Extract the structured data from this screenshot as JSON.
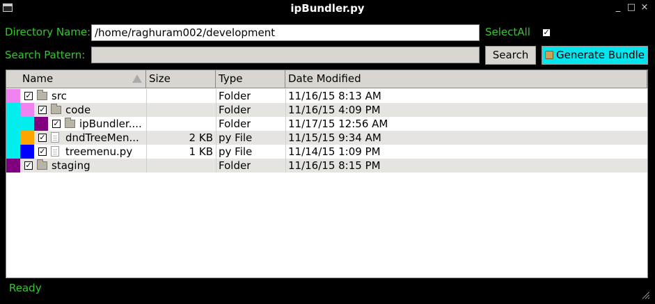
{
  "window": {
    "title": "ipBundler.py",
    "controls": [
      "_",
      "□",
      "×"
    ]
  },
  "form": {
    "dir_label": "Directory Name:",
    "dir_value": "/home/raghuram002/development",
    "selectall_label": "SelectAll",
    "selectall_checked": "✓",
    "pattern_label": "Search Pattern:",
    "pattern_value": "",
    "search_button": "Search",
    "generate_button": "Generate Bundle"
  },
  "tree": {
    "columns": [
      "Name",
      "Size",
      "Type",
      "Date Modified"
    ],
    "rows": [
      {
        "name": "src",
        "size": "",
        "type": "Folder",
        "date": "11/16/15 8:13 AM",
        "checked": "✓",
        "kind": "folder",
        "depth": 0,
        "tags": [
          "#ee82ee"
        ]
      },
      {
        "name": "code",
        "size": "",
        "type": "Folder",
        "date": "11/16/15 4:09 PM",
        "checked": "✓",
        "kind": "folder",
        "depth": 1,
        "tags": [
          "#00eeee",
          "#ee82ee"
        ]
      },
      {
        "name": "ipBundler....",
        "size": "",
        "type": "Folder",
        "date": "11/17/15 12:56 AM",
        "checked": "✓",
        "kind": "folder",
        "depth": 2,
        "tags": [
          "#00eeee",
          "#00eeee",
          "#800080"
        ]
      },
      {
        "name": "dndTreeMen...",
        "size": "2 KB",
        "type": "py File",
        "date": "11/15/15 9:34 AM",
        "checked": "✓",
        "kind": "file",
        "depth": 1,
        "tags": [
          "#00eeee",
          "#ffa500"
        ]
      },
      {
        "name": "treemenu.py",
        "size": "1 KB",
        "type": "py File",
        "date": "11/14/15 1:09 PM",
        "checked": "✓",
        "kind": "file",
        "depth": 1,
        "tags": [
          "#00eeee",
          "#0000ff"
        ]
      },
      {
        "name": "staging",
        "size": "",
        "type": "Folder",
        "date": "11/16/15 8:15 PM",
        "checked": "✓",
        "kind": "folder",
        "depth": 0,
        "tags": [
          "#800080"
        ]
      }
    ]
  },
  "status": {
    "text": "Ready"
  },
  "colors": {
    "label_green": "#2ecc27",
    "accent_cyan": "#00e5ee",
    "button_gray": "#d9d6d1"
  }
}
